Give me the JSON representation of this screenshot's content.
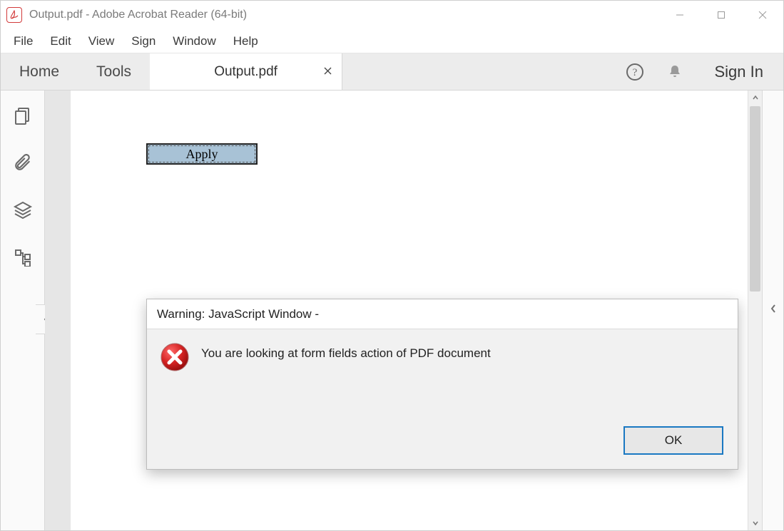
{
  "window": {
    "title": "Output.pdf - Adobe Acrobat Reader (64-bit)",
    "app_icon_label": "A"
  },
  "menu": {
    "file": "File",
    "edit": "Edit",
    "view": "View",
    "sign": "Sign",
    "window": "Window",
    "help": "Help"
  },
  "toolbar": {
    "home": "Home",
    "tools": "Tools",
    "doc_tab": "Output.pdf",
    "sign_in": "Sign In"
  },
  "document": {
    "apply_button": "Apply"
  },
  "dialog": {
    "title": "Warning: JavaScript Window -",
    "message": "You are looking at form fields action of PDF document",
    "ok": "OK"
  }
}
